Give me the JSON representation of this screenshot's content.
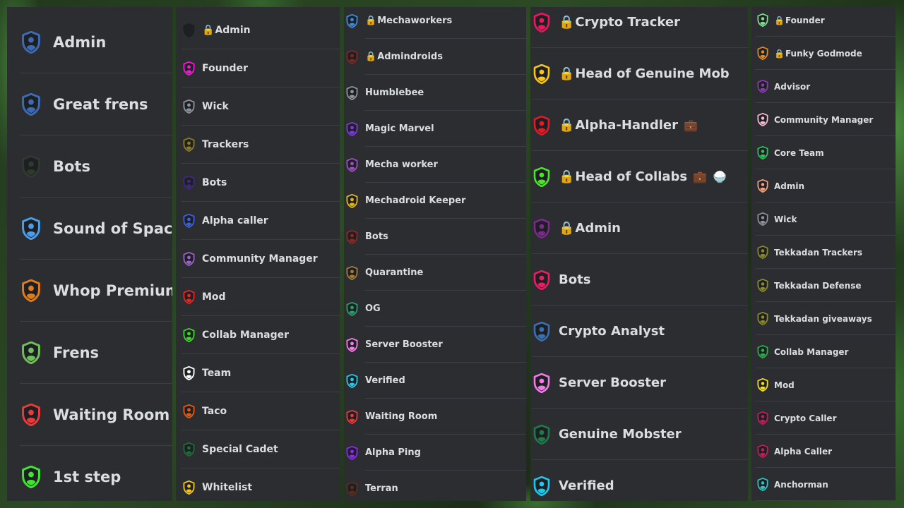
{
  "columns": [
    {
      "id": "col1",
      "roles": [
        {
          "name": "Admin",
          "color": "#3d6bb3"
        },
        {
          "name": "Great frens",
          "color": "#3d6bb3"
        },
        {
          "name": "Bots",
          "color": "#2f3a2f"
        },
        {
          "name": "Sound of Space",
          "color": "#4a9de8"
        },
        {
          "name": "Whop Premium",
          "color": "#e07b1a"
        },
        {
          "name": "Frens",
          "color": "#6fbf5a"
        },
        {
          "name": "Waiting Room",
          "color": "#e83a3a"
        },
        {
          "name": "1st step",
          "color": "#3ee62e"
        }
      ]
    },
    {
      "id": "col2",
      "roles": [
        {
          "name": "Admin",
          "color": "#1e1f22",
          "locked": true,
          "lock": "🔒"
        },
        {
          "name": "Founder",
          "color": "#e91ecf"
        },
        {
          "name": "Wick",
          "color": "#8c929b"
        },
        {
          "name": "Trackers",
          "color": "#8b7a25"
        },
        {
          "name": "Bots",
          "color": "#3f2a7a"
        },
        {
          "name": "Alpha caller",
          "color": "#3c5fd6"
        },
        {
          "name": "Community Manager",
          "color": "#9a61c4"
        },
        {
          "name": "Mod",
          "color": "#e22626"
        },
        {
          "name": "Collab Manager",
          "color": "#3fd22a"
        },
        {
          "name": "Team",
          "color": "#ffffff"
        },
        {
          "name": "Taco",
          "color": "#e05a14"
        },
        {
          "name": "Special Cadet",
          "color": "#1f6b3a"
        },
        {
          "name": "Whitelist",
          "color": "#f0c419"
        }
      ]
    },
    {
      "id": "col3",
      "roles": [
        {
          "name": "Mechaworkers",
          "color": "#3b8ad6",
          "locked": true,
          "lock": "🔒"
        },
        {
          "name": "Admindroids",
          "color": "#7a2a22",
          "locked": true,
          "lock": "🔒"
        },
        {
          "name": "Humblebee",
          "color": "#8c929b"
        },
        {
          "name": "Magic Marvel",
          "color": "#7a3ad6"
        },
        {
          "name": "Mecha worker",
          "color": "#9a4dc0"
        },
        {
          "name": "Mechadroid Keeper",
          "color": "#e0b21a"
        },
        {
          "name": "Bots",
          "color": "#8a2a22"
        },
        {
          "name": "Quarantine",
          "color": "#a07a3a"
        },
        {
          "name": "OG",
          "color": "#2a9a6a"
        },
        {
          "name": "Server Booster",
          "color": "#f07ae6"
        },
        {
          "name": "Verified",
          "color": "#2ac4e6"
        },
        {
          "name": "Waiting Room",
          "color": "#e23a3a"
        },
        {
          "name": "Alpha Ping",
          "color": "#8a2ae6"
        },
        {
          "name": "Terran",
          "color": "#5a2e1e"
        }
      ]
    },
    {
      "id": "col4",
      "roles": [
        {
          "name": "Crypto Tracker",
          "color": "#e9195e",
          "locked": true,
          "lock": "🔒"
        },
        {
          "name": "Head of Genuine Mob",
          "color": "#f5c518",
          "locked": true,
          "lock": "🔒"
        },
        {
          "name": "Alpha-Handler",
          "color": "#e01b24",
          "locked": true,
          "lock": "🔒",
          "extras": [
            "💼"
          ]
        },
        {
          "name": "Head of Collabs",
          "color": "#4de22a",
          "locked": true,
          "lock": "🔒",
          "extras": [
            "💼",
            "🍚"
          ]
        },
        {
          "name": "Admin",
          "color": "#7a2a8a",
          "locked": true,
          "lock": "🔒"
        },
        {
          "name": "Bots",
          "color": "#e91e63"
        },
        {
          "name": "Crypto Analyst",
          "color": "#3a6fb0"
        },
        {
          "name": "Server Booster",
          "color": "#f07ae6"
        },
        {
          "name": "Genuine Mobster",
          "color": "#1f7a4a"
        },
        {
          "name": "Verified",
          "color": "#1ec8e8"
        }
      ]
    },
    {
      "id": "col5",
      "roles": [
        {
          "name": "Founder",
          "color": "#7ee08a",
          "locked": true,
          "lock": "🔒"
        },
        {
          "name": "Funky Godmode",
          "color": "#e0882a",
          "locked": true,
          "lock": "🔒"
        },
        {
          "name": "Advisor",
          "color": "#8a3ab0"
        },
        {
          "name": "Community Manager",
          "color": "#f5b8d0"
        },
        {
          "name": "Core Team",
          "color": "#2ac45a"
        },
        {
          "name": "Admin",
          "color": "#f5a07a"
        },
        {
          "name": "Wick",
          "color": "#8c929b"
        },
        {
          "name": "Tekkadan Trackers",
          "color": "#8a8a2a"
        },
        {
          "name": "Tekkadan Defense",
          "color": "#8a8a2a"
        },
        {
          "name": "Tekkadan giveaways",
          "color": "#8a8a2a"
        },
        {
          "name": "Collab Manager",
          "color": "#2ab04a"
        },
        {
          "name": "Mod",
          "color": "#f5e01a"
        },
        {
          "name": "Crypto Caller",
          "color": "#c41e5a"
        },
        {
          "name": "Alpha Caller",
          "color": "#c41e5a"
        },
        {
          "name": "Anchorman",
          "color": "#2ac4c4"
        }
      ]
    }
  ]
}
